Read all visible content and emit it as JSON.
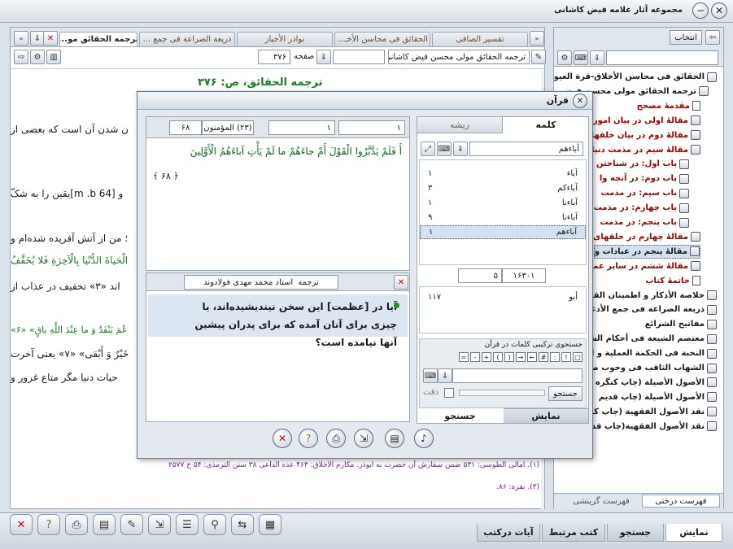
{
  "window": {
    "title": "مجموعه آثار علامه فیض کاشانی"
  },
  "tabs": [
    "ترجمه الحقائق مو...",
    "ذریعة الضراعة فی جمع ...",
    "نوادر الأخبار",
    "الحقائق فی محاسن الأخـ...",
    "تفسیر الصافی"
  ],
  "toolbar": {
    "book_select": "ترجمه الحقائق مولی محسن فیض کاشانی",
    "page_label": "صفحه",
    "page_value": "۳۷۶"
  },
  "doc": {
    "heading": "ترجمه الحقائق، ص: ۳۷۶",
    "lines": [
      "ن شدن آن است که بعضی از",
      "و [m .b 64]یقین را به شکّ",
      "؛ من از آتش آفریده شده‌ام و",
      "الْحَیاةَ الدُّنْیا بِالْآخِرَةِ فَلا یُخَفَّفُ",
      "اند «۳» تخفیف در عذاب از",
      "عْمَ یَنْفَدُ وَ ما عِنْدَ اللَّهِ باقٍ» «۶»",
      "خَیْرٌ وَ أَبْقی» «۷» یعنی آخرت",
      "حیات دنیا مگر متاع غرور و"
    ],
    "footnote1": "(۱). امالی الطوسی: ۵۳۱ ضمن سفارش آن حضرت به ابوذر. مکارم الاخلاق: ۴۶۳ عده الداعی ۳۸ سنن الترمذی: ۵۴ ح ۲۵۷۷",
    "footnote2": "(۳). بقره: ۸۶."
  },
  "right_panel": {
    "button": "انتخاب",
    "tree": [
      {
        "label": "الحقائق فی محاسن الأخلاق-قرة العیون",
        "color": "#1a1a1a",
        "type": "book"
      },
      {
        "label": "ترجمه الحقائق مولی محسن فیض",
        "color": "#1a1a1a",
        "type": "open"
      },
      {
        "label": "مقدمهٔ مصحح",
        "color": "#a00000",
        "type": "doc"
      },
      {
        "label": "مقالهٔ اولی در بیان امور",
        "color": "#a00000",
        "type": "book"
      },
      {
        "label": "مقالهٔ دوم در بیان خلقها",
        "color": "#a00000",
        "type": "book"
      },
      {
        "label": "مقالهٔ سیم در مذمت دنیا",
        "color": "#a00000",
        "type": "open"
      },
      {
        "label": "باب اول: در شناختن",
        "color": "#a00000",
        "type": "book"
      },
      {
        "label": "باب دوم: در آنچه وا",
        "color": "#a00000",
        "type": "book"
      },
      {
        "label": "باب سیم: در مذمت",
        "color": "#a00000",
        "type": "book"
      },
      {
        "label": "باب چهارم: در مذمت",
        "color": "#a00000",
        "type": "book"
      },
      {
        "label": "باب پنجم: در مذمت",
        "color": "#a00000",
        "type": "book"
      },
      {
        "label": "مقالهٔ چهارم در خلقهای",
        "color": "#a00000",
        "type": "book"
      },
      {
        "label": "مقالهٔ پنجم در عبادات و",
        "color": "#1a1a1a",
        "type": "book",
        "selected": true
      },
      {
        "label": "مقالهٔ ششم در سایر عملها",
        "color": "#a00000",
        "type": "book"
      },
      {
        "label": "خاتمهٔ کتاب",
        "color": "#a00000",
        "type": "doc"
      },
      {
        "label": "خلاصة الأذکار و اطمینان القـ",
        "color": "#1a1a1a",
        "type": "book"
      },
      {
        "label": "ذریعة الضراعة فی جمع الأدعـ",
        "color": "#1a1a1a",
        "type": "book"
      },
      {
        "label": "مفاتیح الشرائع",
        "color": "#1a1a1a",
        "type": "book"
      },
      {
        "label": "معتصم الشیعة فی أحکام الشر",
        "color": "#1a1a1a",
        "type": "book"
      },
      {
        "label": "النخبة فی الحکمة العملیة و ا",
        "color": "#1a1a1a",
        "type": "book"
      },
      {
        "label": "الشهاب الثاقب فی وجوب صلا",
        "color": "#1a1a1a",
        "type": "book"
      },
      {
        "label": "الأصول الأصیلة (چاپ کنگره",
        "color": "#1a1a1a",
        "type": "book"
      },
      {
        "label": "الأصول الأصیلة (چاپ قدیم",
        "color": "#1a1a1a",
        "type": "book"
      },
      {
        "label": "نقد الأصول الفقهیة (چاپ کنـ",
        "color": "#1a1a1a",
        "type": "book"
      },
      {
        "label": "نقد الأصول الفقهیة(چاپ قدیم)",
        "color": "#1a1a1a",
        "type": "book"
      }
    ],
    "bottom_tabs": [
      "فهرست درختی",
      "فهرست گزینشی"
    ]
  },
  "bottom_tabs": [
    "نمایش",
    "جستجو",
    "کتب مرتبط",
    "آیات درکتب"
  ],
  "dialog": {
    "title": "قرآن",
    "verse_nav": {
      "a": "۱",
      "b": "۱",
      "c": "(۲۳) المؤمنون",
      "d": "۶۸"
    },
    "verse": "أَ فَلَمْ یَدَّبَّرُوا الْقَوْلَ أَمْ جاءَهُمْ ما لَمْ یَأْتِ آباءَهُمُ الْأَوَّلِینَ",
    "verse_number": "﴿ ۶۸ ﴾",
    "translation_label": "ترجمه",
    "translator": "استاد محمد مهدی فولادوند",
    "translation": "آیا در [عظمت] این سخن نیندیشیده‌اند، یا چیزی برای آنان آمده که برای پدران پیشین آنها نیامده است؟",
    "tab_word": "کلمه",
    "tab_root": "ریشه",
    "search_word": "آباءهم",
    "words": [
      {
        "w": "آباء",
        "n": "۱"
      },
      {
        "w": "آباءکم",
        "n": "۳"
      },
      {
        "w": "آباءنا",
        "n": "۱"
      },
      {
        "w": "آباءنا",
        "n": "۹"
      },
      {
        "w": "آباءهم",
        "n": "۱"
      }
    ],
    "count_a": "۱۶۳۰۱",
    "count_b": "۵",
    "result_word": "أبو",
    "result_count": "۱۱۷",
    "combined_search_label": "جستجوی ترکیبی کلمات در قرآن",
    "search_button": "جستجو",
    "exact_label": "دقت",
    "bottom_tab_show": "نمایش",
    "bottom_tab_search": "جستجو",
    "symbols": [
      "□",
      "!",
      ":",
      "#",
      "←",
      "→",
      "(",
      ")",
      "+",
      "-",
      "="
    ]
  }
}
